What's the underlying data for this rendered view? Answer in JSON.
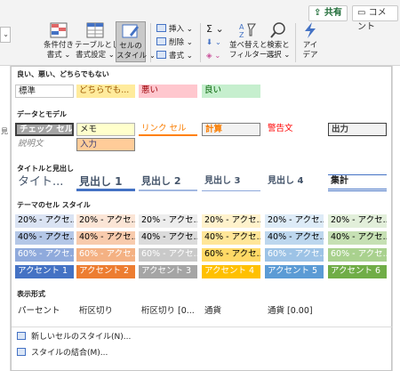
{
  "header": {
    "share_label": "共有",
    "comment_label": "コメント",
    "share_icon": "share-icon",
    "comment_icon": "comment-icon"
  },
  "ribbon": {
    "conditional_format": "条件付き\n書式 ⌄",
    "format_as_table": "テーブルとして\n書式設定 ⌄",
    "cell_styles": "セルの\nスタイル ⌄",
    "insert": "挿入 ⌄",
    "delete": "削除 ⌄",
    "format": "書式 ⌄",
    "autosum": "Σ ⌄",
    "fill": "⬇ ⌄",
    "clear": "◈ ⌄",
    "sort_filter": "並べ替えと\nフィルター ⌄",
    "find_select": "検索と\n選択 ⌄",
    "ideas": "アイ\nデア"
  },
  "sheet": {
    "cell_label": "見"
  },
  "gallery": {
    "sections": {
      "good_bad": "良い、悪い、どちらでもない",
      "data_model": "データとモデル",
      "titles": "タイトルと見出し",
      "themed": "テーマのセル スタイル",
      "number_format": "表示形式"
    },
    "good_bad": [
      "標準",
      "どちらでも...",
      "悪い",
      "良い"
    ],
    "data_model": [
      "チェック セル",
      "メモ",
      "リンク セル",
      "計算",
      "警告文",
      "出力",
      "説明文",
      "入力"
    ],
    "titles": [
      "タイト...",
      "見出し 1",
      "見出し 2",
      "見出し 3",
      "見出し 4",
      "集計"
    ],
    "themed_20": [
      "20% - アクセ...",
      "20% - アクセ...",
      "20% - アクセ...",
      "20% - アクセ...",
      "20% - アクセ...",
      "20% - アクセ..."
    ],
    "themed_40": [
      "40% - アクセ...",
      "40% - アクセ...",
      "40% - アクセ...",
      "40% - アクセ...",
      "40% - アクセ...",
      "40% - アクセ..."
    ],
    "themed_60": [
      "60% - アクセ...",
      "60% - アクセ...",
      "60% - アクセ...",
      "60% - アクセ...",
      "60% - アクセ...",
      "60% - アクセ..."
    ],
    "accent": [
      "アクセント 1",
      "アクセント 2",
      "アクセント 3",
      "アクセント 4",
      "アクセント 5",
      "アクセント 6"
    ],
    "number_format": [
      "パーセント",
      "桁区切り",
      "桁区切り [0...",
      "通貨",
      "通貨 [0.00]"
    ],
    "commands": [
      "新しいセルのスタイル(N)...",
      "スタイルの結合(M)..."
    ]
  },
  "colors": {
    "accent_20": [
      "#dae3f3",
      "#fbe5d6",
      "#ededed",
      "#fff2cc",
      "#ddebf7",
      "#e2efda"
    ],
    "accent_40": [
      "#b4c7e7",
      "#f8cbad",
      "#dbdbdb",
      "#ffe699",
      "#bdd7ee",
      "#c6e0b4"
    ],
    "accent_60": [
      "#8faadc",
      "#f4b183",
      "#c9c9c9",
      "#ffd966",
      "#9dc3e6",
      "#a9d18e"
    ],
    "accent_100": [
      "#4472c4",
      "#ed7d31",
      "#a5a5a5",
      "#ffc000",
      "#5b9bd5",
      "#70ad47"
    ]
  }
}
